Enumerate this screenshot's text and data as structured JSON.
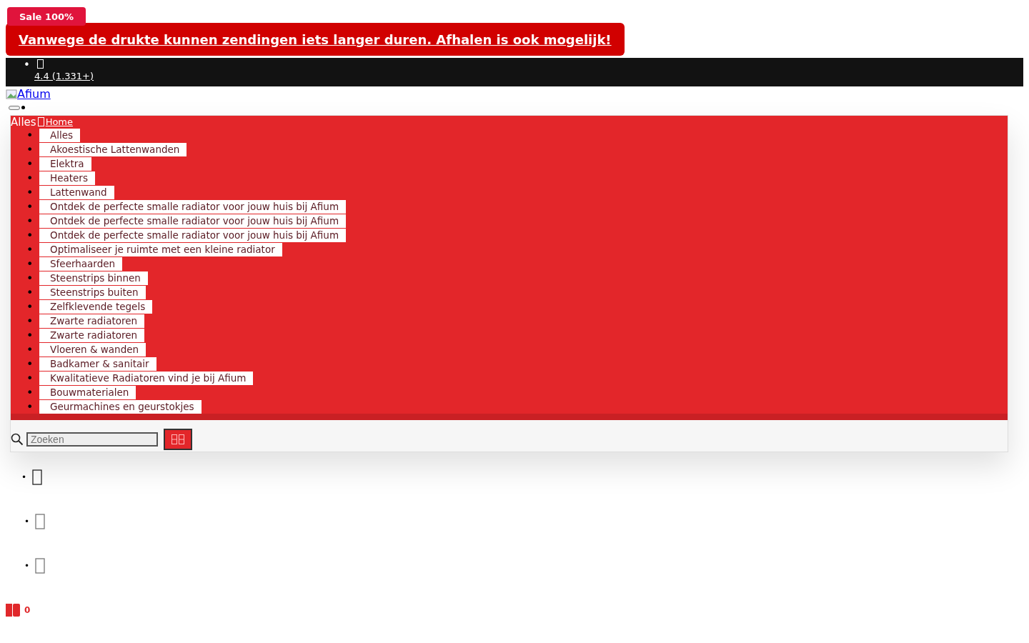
{
  "sale_badge": "Sale 100%",
  "notice": "Vanwege de drukte kunnen zendingen iets langer duren. Afhalen is ook mogelijk!",
  "rating": {
    "bullet": "•",
    "text": "4.4 (1.331+)"
  },
  "logo_alt": "Afium",
  "nav": {
    "dropdown_label": "Alles",
    "home": "Home",
    "items": [
      {
        "bullet": "•",
        "label": "Alles"
      },
      {
        "bullet": "•",
        "label": "Akoestische Lattenwanden"
      },
      {
        "bullet": "•",
        "label": "Elektra"
      },
      {
        "bullet": "•",
        "label": "Heaters"
      },
      {
        "bullet": "•",
        "label": "Lattenwand"
      },
      {
        "bullet": "•",
        "label": "Ontdek de perfecte smalle radiator voor jouw huis bij Afium"
      },
      {
        "bullet": "•",
        "label": "Ontdek de perfecte smalle radiator voor jouw huis bij Afium"
      },
      {
        "bullet": "•",
        "label": "Ontdek de perfecte smalle radiator voor jouw huis bij Afium"
      },
      {
        "bullet": "•",
        "label": "Optimaliseer je ruimte met een kleine radiator"
      },
      {
        "bullet": "•",
        "label": "Sfeerhaarden"
      },
      {
        "bullet": "•",
        "label": "Steenstrips binnen"
      },
      {
        "bullet": "•",
        "label": "Steenstrips buiten"
      },
      {
        "bullet": "•",
        "label": "Zelfklevende tegels"
      },
      {
        "bullet": "•",
        "label": "Zwarte radiatoren"
      },
      {
        "bullet": "•",
        "label": "Zwarte radiatoren"
      },
      {
        "bullet": "•",
        "label": "Vloeren & wanden"
      },
      {
        "bullet": "•",
        "label": "Badkamer & sanitair"
      },
      {
        "bullet": "•",
        "label": "Kwalitatieve Radiatoren vind je bij Afium"
      },
      {
        "bullet": "•",
        "label": "Bouwmaterialen"
      },
      {
        "bullet": "•",
        "label": "Geurmachines en geurstokjes"
      }
    ]
  },
  "search": {
    "placeholder": "Zoeken"
  },
  "icon_list": [
    {
      "bullet": "•"
    },
    {
      "bullet": "•"
    },
    {
      "bullet": "•"
    }
  ],
  "cart": {
    "count": "0"
  }
}
